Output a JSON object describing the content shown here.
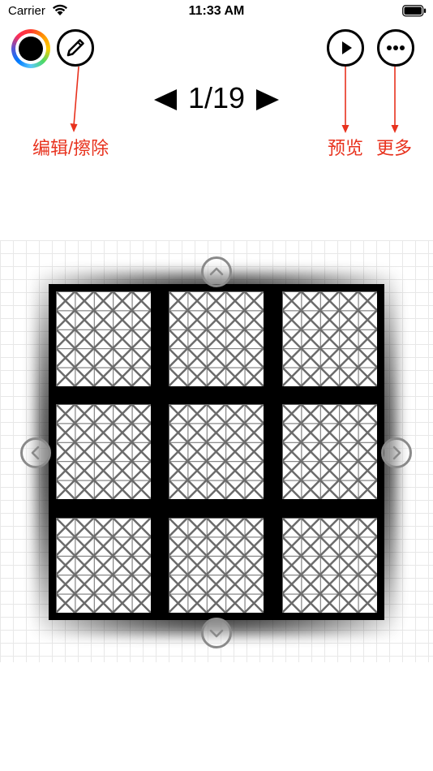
{
  "status_bar": {
    "carrier": "Carrier",
    "time": "11:33 AM",
    "wifi_icon": "wifi-icon",
    "battery_icon": "battery-icon"
  },
  "toolbar": {
    "color_picker": {
      "icon": "color-wheel-icon",
      "selected_color": "#000000"
    },
    "edit_button": {
      "icon": "pencil-icon"
    },
    "preview_button": {
      "icon": "play-icon"
    },
    "more_button": {
      "icon": "ellipsis-icon"
    }
  },
  "pager": {
    "label": "1/19",
    "current": 1,
    "total": 19,
    "prev_icon": "triangle-left-icon",
    "next_icon": "triangle-right-icon"
  },
  "annotations": {
    "edit": "编辑/擦除",
    "preview": "预览",
    "more": "更多",
    "color": "#e8321e"
  },
  "canvas": {
    "rows": 3,
    "cols": 3,
    "tile_pattern": "cross-hatch",
    "nudge_icons": [
      "chevron-up-icon",
      "chevron-down-icon",
      "chevron-left-icon",
      "chevron-right-icon"
    ]
  }
}
